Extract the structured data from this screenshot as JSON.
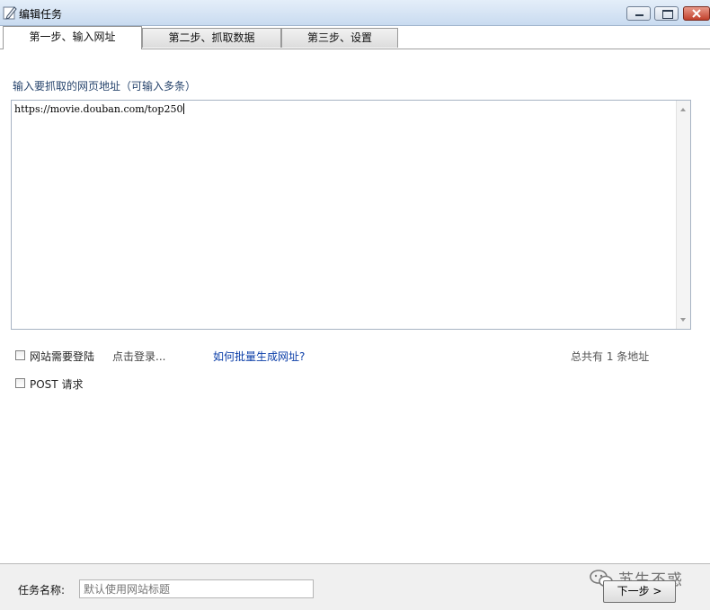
{
  "window": {
    "title": "编辑任务",
    "title_icon": "edit-pencil-icon"
  },
  "tabs": [
    {
      "label": "第一步、输入网址",
      "active": true
    },
    {
      "label": "第二步、抓取数据",
      "active": false
    },
    {
      "label": "第三步、设置",
      "active": false
    }
  ],
  "url_section": {
    "label": "输入要抓取的网页地址（可输入多条）",
    "value": "https://movie.douban.com/top250"
  },
  "options": {
    "login_required_label": "网站需要登陆",
    "login_required_checked": false,
    "login_link": "点击登录...",
    "batch_link": "如何批量生成网址?",
    "url_count_text": "总共有 1 条地址",
    "post_label": "POST 请求",
    "post_checked": false
  },
  "footer": {
    "name_label": "任务名称:",
    "name_placeholder": "默认使用网站标题",
    "name_value": "",
    "next_label": "下一步 >"
  },
  "watermark": {
    "text": "苏生不惑",
    "icon": "wechat-icon"
  },
  "colors": {
    "titlebar": "#c9dbf0",
    "label_blue": "#29466e",
    "link_blue": "#0b3ea8",
    "close_red": "#c2412c"
  }
}
